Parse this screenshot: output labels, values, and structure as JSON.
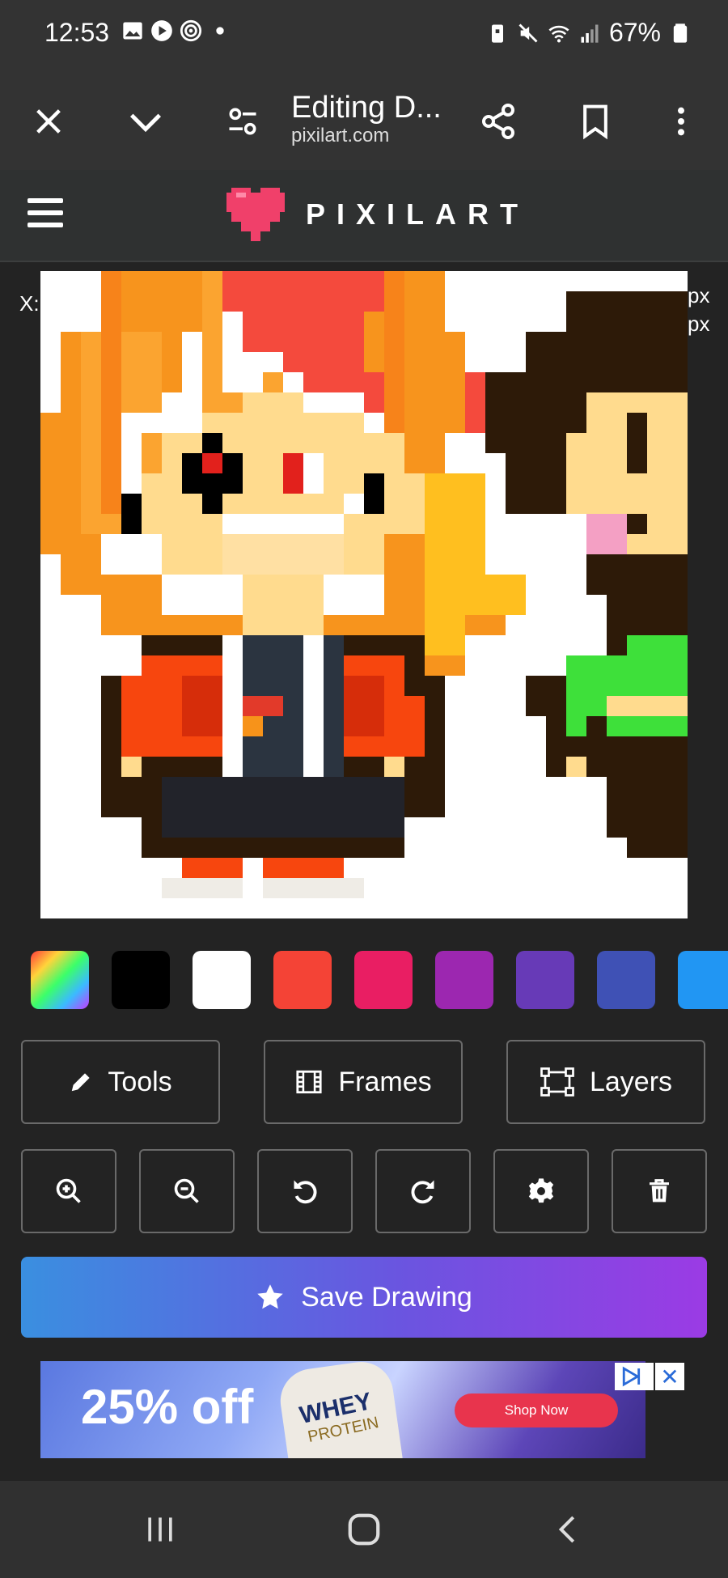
{
  "status_bar": {
    "time": "12:53",
    "battery": "67%",
    "icons_left": [
      "gallery-icon",
      "youtube-icon",
      "podcast-icon",
      "dot-icon"
    ],
    "icons_right": [
      "battery-saver-icon",
      "mute-icon",
      "wifi-icon",
      "signal-icon",
      "battery-icon"
    ]
  },
  "browser": {
    "title": "Editing D...",
    "url": "pixilart.com",
    "buttons": [
      "close-icon",
      "chevron-down-icon",
      "tune-icon",
      "share-icon",
      "bookmark-icon",
      "more-icon"
    ]
  },
  "app": {
    "logo_text": "PIXILART",
    "coord_x": "X:",
    "coord_right_1": "px",
    "coord_right_2": "px"
  },
  "palette": {
    "colors": [
      "rainbow",
      "#000000",
      "#ffffff",
      "#f44336",
      "#e91e63",
      "#9c27b0",
      "#673ab7",
      "#3f51b5",
      "#2196f3"
    ]
  },
  "toolbar": {
    "tools_label": "Tools",
    "frames_label": "Frames",
    "layers_label": "Layers"
  },
  "actions": [
    "zoom-in-icon",
    "zoom-out-icon",
    "undo-icon",
    "redo-icon",
    "settings-icon",
    "trash-icon"
  ],
  "save": {
    "label": "Save Drawing"
  },
  "ad": {
    "discount": "25% off",
    "product": "WHEY",
    "product_sub": "PROTEIN",
    "cta": "Shop Now",
    "close": "✕"
  },
  "nav": [
    "recents-icon",
    "home-icon",
    "back-icon"
  ]
}
